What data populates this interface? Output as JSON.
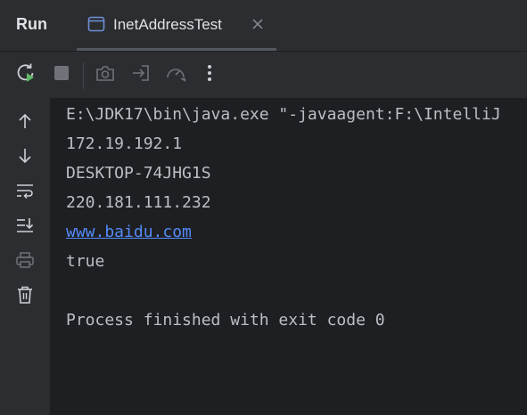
{
  "header": {
    "panel_title": "Run",
    "tab": {
      "label": "InetAddressTest"
    }
  },
  "toolbar": {
    "buttons": [
      {
        "name": "rerun-icon",
        "enabled": true
      },
      {
        "name": "stop-icon",
        "enabled": false
      },
      {
        "name": "camera-icon",
        "enabled": false
      },
      {
        "name": "exit-icon",
        "enabled": false
      },
      {
        "name": "gauge-icon",
        "enabled": false
      },
      {
        "name": "more-icon",
        "enabled": true
      }
    ]
  },
  "sidebar": {
    "buttons": [
      {
        "name": "arrow-up-icon"
      },
      {
        "name": "arrow-down-icon"
      },
      {
        "name": "soft-wrap-icon"
      },
      {
        "name": "scroll-to-end-icon"
      },
      {
        "name": "print-icon"
      },
      {
        "name": "trash-icon"
      }
    ]
  },
  "console": {
    "lines": [
      "E:\\JDK17\\bin\\java.exe \"-javaagent:F:\\IntelliJ",
      "172.19.192.1",
      "DESKTOP-74JHG1S",
      "220.181.111.232",
      "www.baidu.com",
      "true",
      "",
      "Process finished with exit code 0"
    ]
  },
  "colors": {
    "panel_bg": "#2b2d30",
    "console_bg": "#1e1f22",
    "console_text": "#bcbec4",
    "link": "#548af7",
    "rerun_accent": "#5fb865"
  }
}
